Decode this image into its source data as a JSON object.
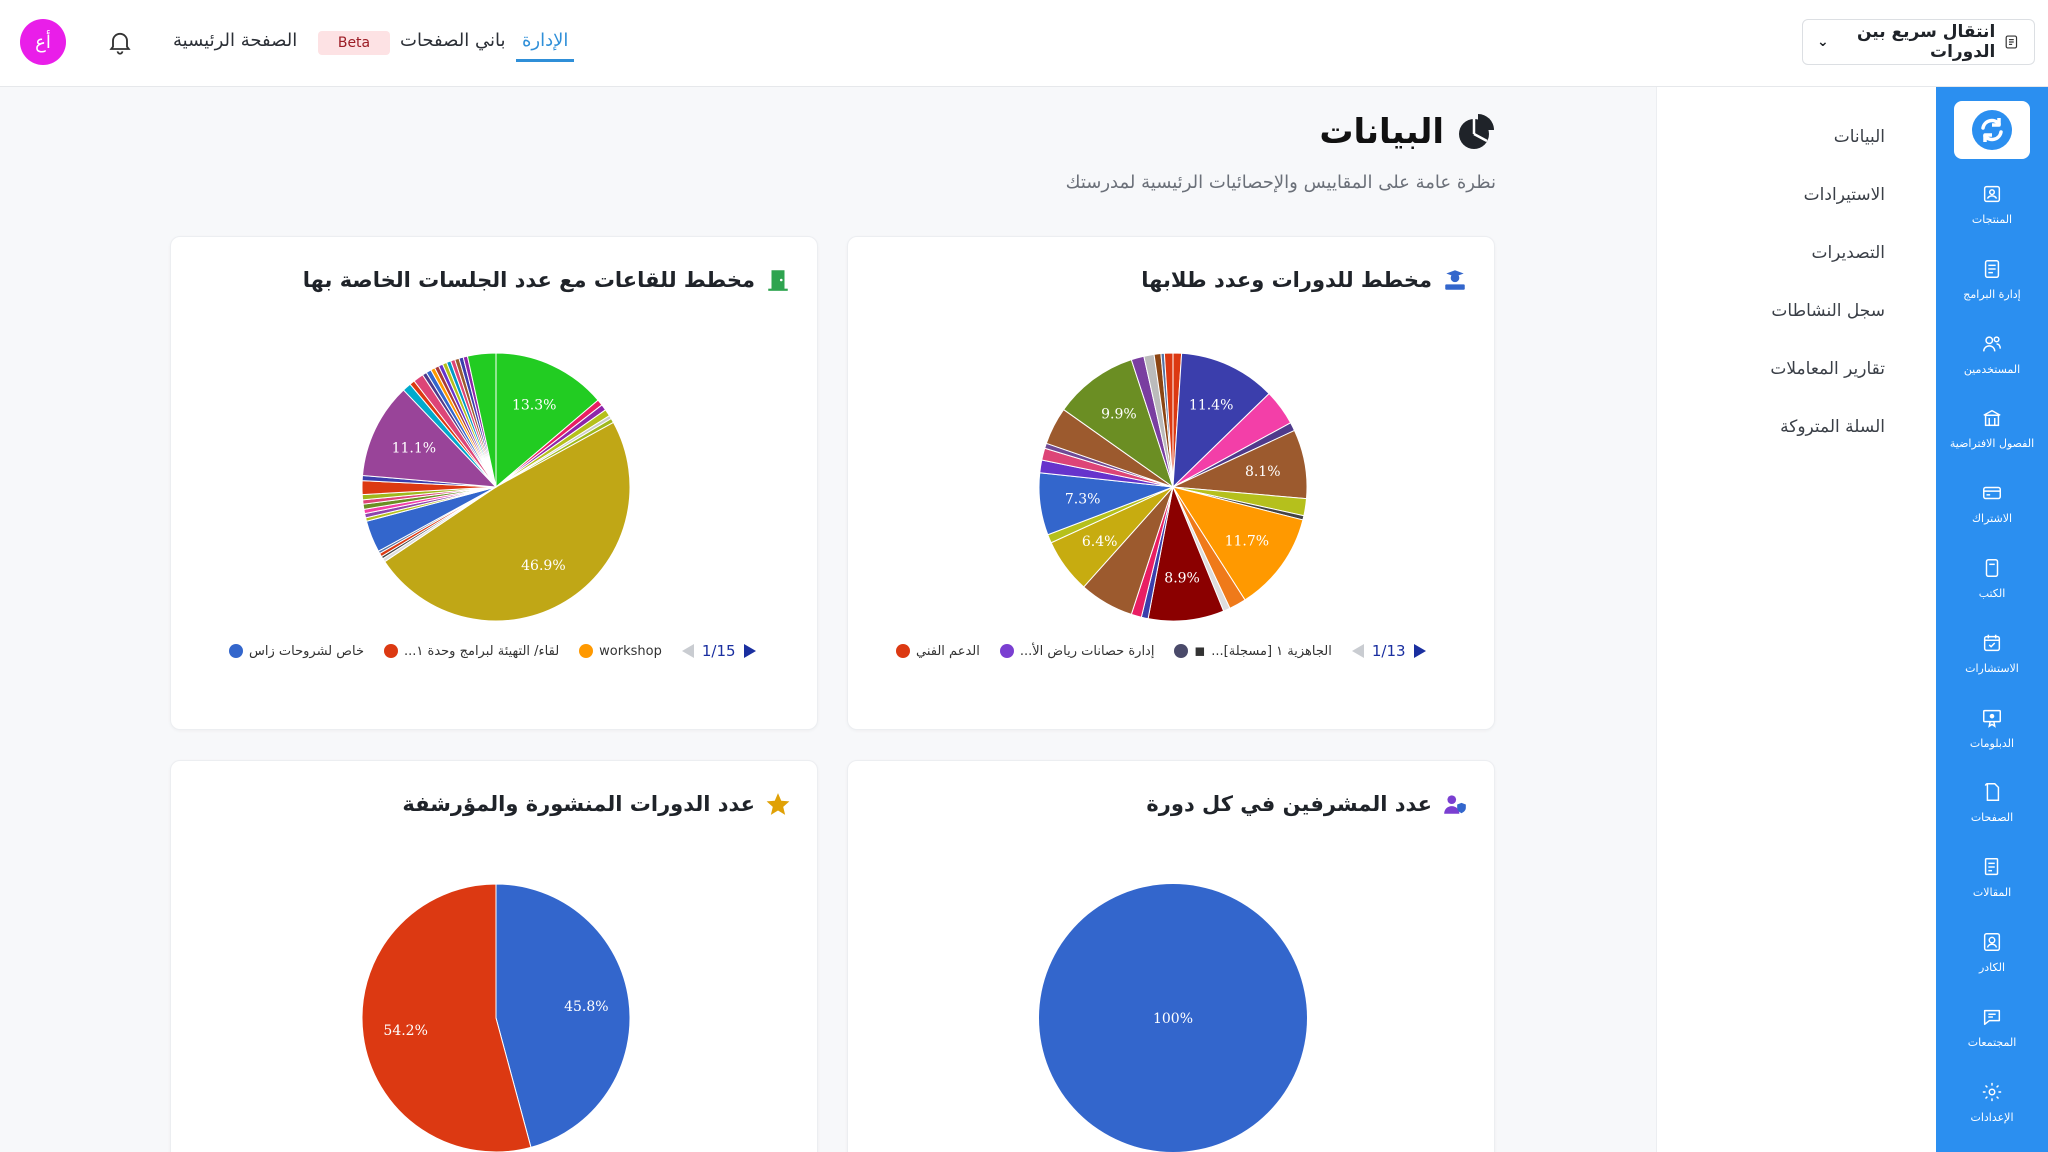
{
  "topbar": {
    "avatar_text": "أع",
    "home": "الصفحة الرئيسية",
    "beta": "Beta",
    "page_builder": "باني الصفحات",
    "admin": "الإدارة",
    "quick_switch": "انتقال سريع بين الدورات"
  },
  "rail": {
    "items": [
      {
        "label": "المنتجات",
        "icon": "product-icon"
      },
      {
        "label": "إدارة البرامج",
        "icon": "program-icon"
      },
      {
        "label": "المستخدمين",
        "icon": "users-icon"
      },
      {
        "label": "الفصول الافتراضية",
        "icon": "classroom-icon"
      },
      {
        "label": "الاشتراك",
        "icon": "card-icon"
      },
      {
        "label": "الكتب",
        "icon": "book-icon"
      },
      {
        "label": "الاستشارات",
        "icon": "calendar-icon"
      },
      {
        "label": "الدبلومات",
        "icon": "diploma-icon"
      },
      {
        "label": "الصفحات",
        "icon": "page-icon"
      },
      {
        "label": "المقالات",
        "icon": "article-icon"
      },
      {
        "label": "الكادر",
        "icon": "staff-icon"
      },
      {
        "label": "المجتمعات",
        "icon": "chat-icon"
      },
      {
        "label": "الإعدادات",
        "icon": "gear-icon"
      }
    ]
  },
  "sidenav": {
    "items": [
      {
        "label": "البيانات",
        "active": true
      },
      {
        "label": "الاستيرادات",
        "active": false
      },
      {
        "label": "التصديرات",
        "active": false
      },
      {
        "label": "سجل النشاطات",
        "active": false
      },
      {
        "label": "تقارير المعاملات",
        "active": false
      },
      {
        "label": "السلة المتروكة",
        "active": false
      }
    ]
  },
  "header": {
    "title": "البيانات",
    "subtitle": "نظرة عامة على المقاييس والإحصائيات الرئيسية لمدرستك"
  },
  "cards": {
    "courses_students": {
      "title": "مخطط للدورات وعدد طلابها",
      "legend": [
        "...الجاهزية ١ [مسجلة]",
        "...إدارة حصانات رياض الأ",
        "الدعم الفني"
      ],
      "legend_colors": [
        "#4a4a6a",
        "#7a3fd1",
        "#dc3912"
      ],
      "legend_icon": "video-camera-icon",
      "page": "1/13"
    },
    "rooms_sessions": {
      "title": "مخطط للقاعات مع عدد الجلسات الخاصة بها",
      "legend": [
        "workshop",
        "...لقاء/ التهيئة لبرامج وحدة ١",
        "خاص لشروحات زاس"
      ],
      "legend_colors": [
        "#ff9900",
        "#dc3912",
        "#3366cc"
      ],
      "page": "1/15"
    },
    "supervisors": {
      "title": "عدد المشرفين في كل دورة"
    },
    "published_archived": {
      "title": "عدد الدورات المنشورة والمؤرشفة"
    }
  },
  "chart_data": [
    {
      "type": "pie",
      "title": "مخطط للدورات وعدد طلابها",
      "values": [
        1.0,
        11.4,
        4.2,
        1.0,
        8.1,
        2.0,
        0.5,
        11.7,
        2.0,
        0.8,
        8.9,
        0.8,
        1.2,
        6.4,
        6.4,
        1.0,
        7.3,
        1.5,
        1.4,
        0.6,
        4.4,
        9.9,
        1.5,
        1.2,
        0.8,
        0.4,
        1.0
      ],
      "labels": [
        "",
        "11.4%",
        "",
        "",
        "8.1%",
        "",
        "",
        "11.7%",
        "",
        "",
        "8.9%",
        "",
        "",
        "",
        "6.4%",
        "",
        "7.3%",
        "",
        "",
        "",
        "",
        "9.9%",
        "",
        "",
        "",
        "",
        ""
      ],
      "colors": [
        "#dc3912",
        "#3b3eac",
        "#f33fa8",
        "#4f3a8b",
        "#9c5a2e",
        "#b5c01c",
        "#444444",
        "#ff9900",
        "#ef7a1a",
        "#dddddd",
        "#8b0000",
        "#3b3eac",
        "#e91e63",
        "#9c5a2e",
        "#c7ac10",
        "#b5c01c",
        "#3366cc",
        "#6633cc",
        "#dd4477",
        "#6f4a96",
        "#9c5a2e",
        "#6b8e23",
        "#7a3ea0",
        "#bbbbbb",
        "#8b4513",
        "#5574a6",
        "#dc3912"
      ]
    },
    {
      "type": "pie",
      "title": "مخطط للقاعات مع عدد الجلسات الخاصة بها",
      "values": [
        13.3,
        0.7,
        0.7,
        0.8,
        0.4,
        0.5,
        46.9,
        0.4,
        0.3,
        0.4,
        0.3,
        3.7,
        0.4,
        0.5,
        0.5,
        0.6,
        0.5,
        0.6,
        1.6,
        0.6,
        11.1,
        1.0,
        0.6,
        1.2,
        0.5,
        0.6,
        0.5,
        0.5,
        0.5,
        0.5,
        0.5,
        0.5,
        0.5,
        0.5,
        0.5,
        3.3
      ],
      "labels": [
        "13.3%",
        "",
        "",
        "",
        "",
        "",
        "46.9%",
        "",
        "",
        "",
        "",
        "",
        "",
        "",
        "",
        "",
        "",
        "",
        "",
        "",
        "11.1%",
        "",
        "",
        "",
        "",
        "",
        "",
        "",
        "",
        "",
        "",
        "",
        "",
        "",
        "",
        ""
      ],
      "colors": [
        "#22cc22",
        "#e91e63",
        "#8e24aa",
        "#b5c01c",
        "#cccccc",
        "#9fb81c",
        "#c0a716",
        "#dddddd",
        "#444444",
        "#dc3912",
        "#5574a6",
        "#3366cc",
        "#b5c01c",
        "#8e44ad",
        "#f33fa8",
        "#6b8e23",
        "#dd4477",
        "#9fb81c",
        "#dc3912",
        "#3b3eac",
        "#994499",
        "#00aacc",
        "#dc3912",
        "#dd4477",
        "#4f3a8b",
        "#3366cc",
        "#ff9900",
        "#aa3a3a",
        "#6633cc",
        "#b5c01c",
        "#0099c6",
        "#dd4477",
        "#9c5a2e",
        "#3b3eac",
        "#8e24aa",
        "#22cc22"
      ]
    },
    {
      "type": "pie",
      "title": "عدد المشرفين في كل دورة",
      "values": [
        100
      ],
      "labels": [
        "100%"
      ],
      "colors": [
        "#3366cc"
      ]
    },
    {
      "type": "pie",
      "title": "عدد الدورات المنشورة والمؤرشفة",
      "values": [
        45.8,
        54.2
      ],
      "labels": [
        "45.8%",
        "54.2%"
      ],
      "colors": [
        "#3366cc",
        "#dc3912"
      ]
    }
  ]
}
